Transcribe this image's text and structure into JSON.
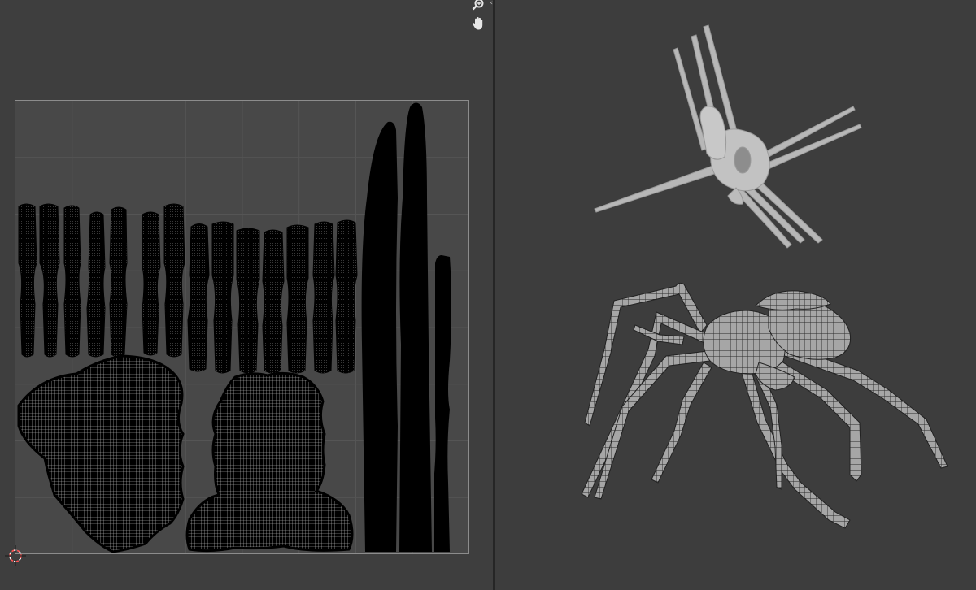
{
  "uv_editor": {
    "nav_icons": [
      "zoom-icon",
      "hand-pan-icon"
    ],
    "split_handle_icon": "split-arrows-icon",
    "grid_divisions": 8,
    "island_color": "#000000",
    "wire_color": "#ffffff",
    "cursor_icon": "crosshair-cursor-icon",
    "cursor_colors": [
      "#ff5555",
      "#ffffff"
    ]
  },
  "viewport": {
    "meshes": [
      {
        "name": "spider-mesh-solid-view",
        "shading": "solid",
        "color": "#b5b5b5"
      },
      {
        "name": "spider-mesh-wireframe-view",
        "shading": "wireframe",
        "color": "#cfcfcf"
      }
    ]
  },
  "colors": {
    "editor_bg": "#3e3e3e",
    "viewport_bg": "#3d3d3d",
    "divider": "#262626",
    "uv_bounds_fill": "#484848",
    "uv_bounds_border": "#8c8c8c"
  }
}
